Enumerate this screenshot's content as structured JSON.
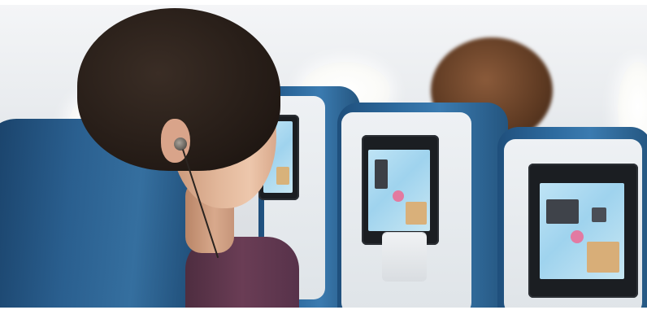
{
  "scene": {
    "description_tags": [
      "airplane-cabin",
      "passenger-with-earphones",
      "seatback-screens"
    ],
    "colors": {
      "seat_blue": "#2d6a9e",
      "cabin_white": "#eef0f3",
      "screen_blue": "#9fd3ee",
      "shirt_purple": "#6a3d55"
    }
  }
}
